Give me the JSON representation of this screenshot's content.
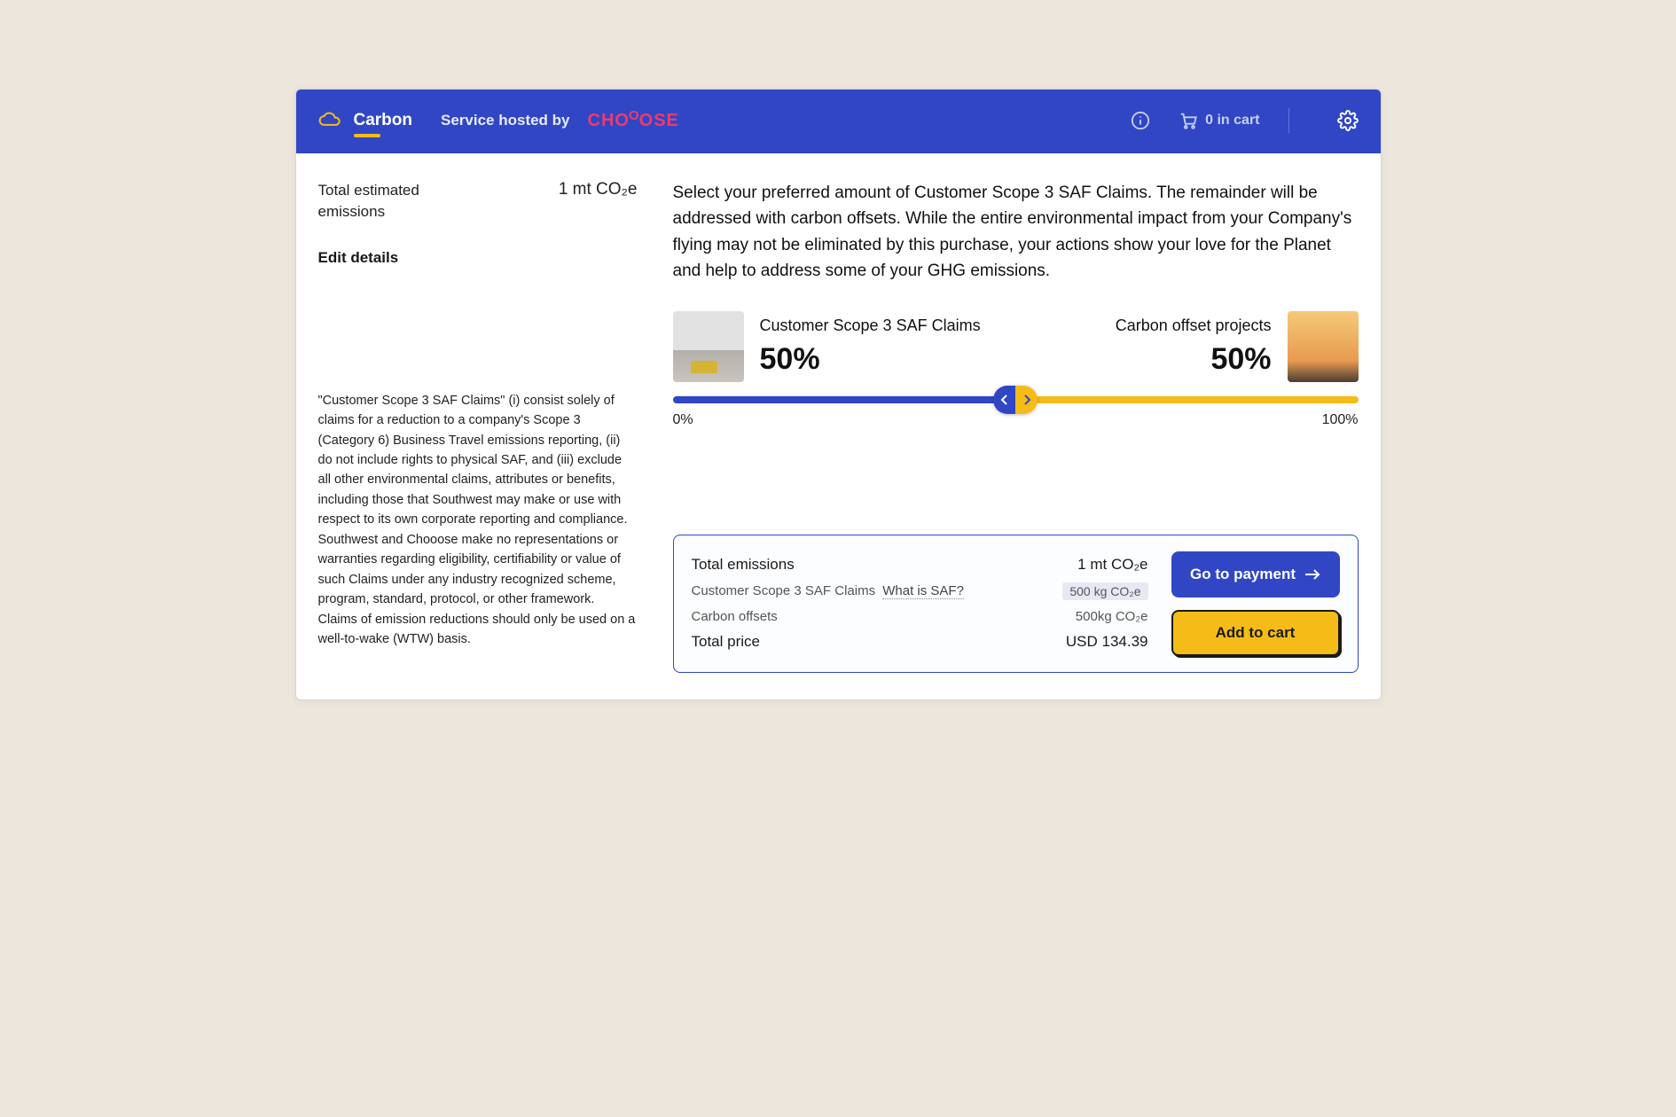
{
  "header": {
    "brand": "Carbon",
    "hosted_by": "Service hosted by",
    "partner": "CHOOOSE",
    "cart_text": "0 in cart"
  },
  "left": {
    "emissions_label": "Total estimated emissions",
    "emissions_value_num": "1",
    "emissions_value_unit": "mt CO₂e",
    "edit": "Edit details",
    "fineprint": "\"Customer Scope 3 SAF Claims\" (i) consist solely of claims for a reduction to a company's Scope 3 (Category 6) Business Travel emissions reporting, (ii) do not include rights to physical SAF, and (iii) exclude all other environmental claims, attributes or benefits, including those that Southwest may make or use with respect to its own corporate reporting and compliance. Southwest and Chooose make no representations or warranties regarding eligibility, certifiability or value of such Claims under any industry recognized scheme, program, standard, protocol, or other framework. Claims of emission reductions should only be used on a well-to-wake (WTW) basis."
  },
  "right": {
    "intro": "Select your preferred amount of Customer Scope 3 SAF Claims. The remainder will be addressed with carbon offsets. While the entire environmental impact from your Company's flying may not be eliminated by this purchase, your actions show your love for the Planet and help to address some of your GHG emissions.",
    "saf_title": "Customer Scope 3 SAF Claims",
    "saf_pct": "50%",
    "offset_title": "Carbon offset projects",
    "offset_pct": "50%",
    "slider_min": "0%",
    "slider_max": "100%"
  },
  "summary": {
    "total_emissions_label": "Total emissions",
    "total_emissions_value": "1 mt CO₂e",
    "saf_label": "Customer Scope 3 SAF Claims",
    "whatis": "What is SAF?",
    "saf_value": "500 kg CO₂e",
    "offsets_label": "Carbon offsets",
    "offsets_value": "500kg CO₂e",
    "price_label": "Total price",
    "price_value": "USD 134.39",
    "go_to_payment": "Go to payment",
    "add_to_cart": "Add to cart"
  },
  "colors": {
    "primary": "#3046c5",
    "accent": "#f5bc17",
    "partner": "#ee3b6b"
  }
}
